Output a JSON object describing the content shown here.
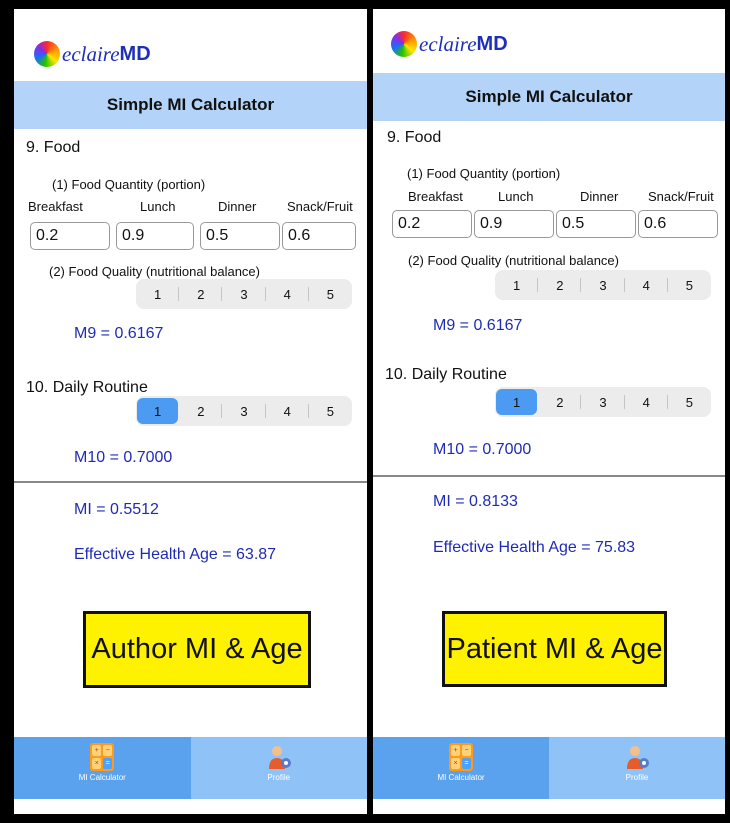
{
  "brand": {
    "name_prefix": "eclaire",
    "name_suffix": "MD"
  },
  "screen_title": "Simple MI Calculator",
  "food": {
    "section_label": "9. Food",
    "quantity_label": "(1) Food Quantity (portion)",
    "columns": [
      "Breakfast",
      "Lunch",
      "Dinner",
      "Snack/Fruit"
    ],
    "quality_label": "(2) Food Quality (nutritional balance)",
    "quality_options": [
      "1",
      "2",
      "3",
      "4",
      "5"
    ]
  },
  "routine": {
    "section_label": "10. Daily Routine",
    "options": [
      "1",
      "2",
      "3",
      "4",
      "5"
    ]
  },
  "tabs": [
    {
      "label": "MI Calculator",
      "icon": "calculator-icon",
      "active": true
    },
    {
      "label": "Profile",
      "icon": "profile-icon",
      "active": false
    }
  ],
  "panels": [
    {
      "id": "author",
      "food_values": [
        "0.2",
        "0.9",
        "0.5",
        "0.6"
      ],
      "m9": "M9 = 0.6167",
      "routine_selected": "1",
      "m10": "M10 = 0.7000",
      "mi": "MI = 0.5512",
      "health_age": "Effective Health Age = 63.87",
      "callout": "Author MI & Age"
    },
    {
      "id": "patient",
      "food_values": [
        "0.2",
        "0.9",
        "0.5",
        "0.6"
      ],
      "m9": "M9 = 0.6167",
      "routine_selected": "1",
      "m10": "M10 = 0.7000",
      "mi": "MI = 0.8133",
      "health_age": "Effective Health Age = 75.83",
      "callout": "Patient MI & Age"
    }
  ],
  "colors": {
    "accent": "#4b9bf3",
    "header": "#b3d4f8",
    "tabbar": "#8fc3f7",
    "metric_text": "#1f2bb5",
    "callout_bg": "#fff200"
  }
}
